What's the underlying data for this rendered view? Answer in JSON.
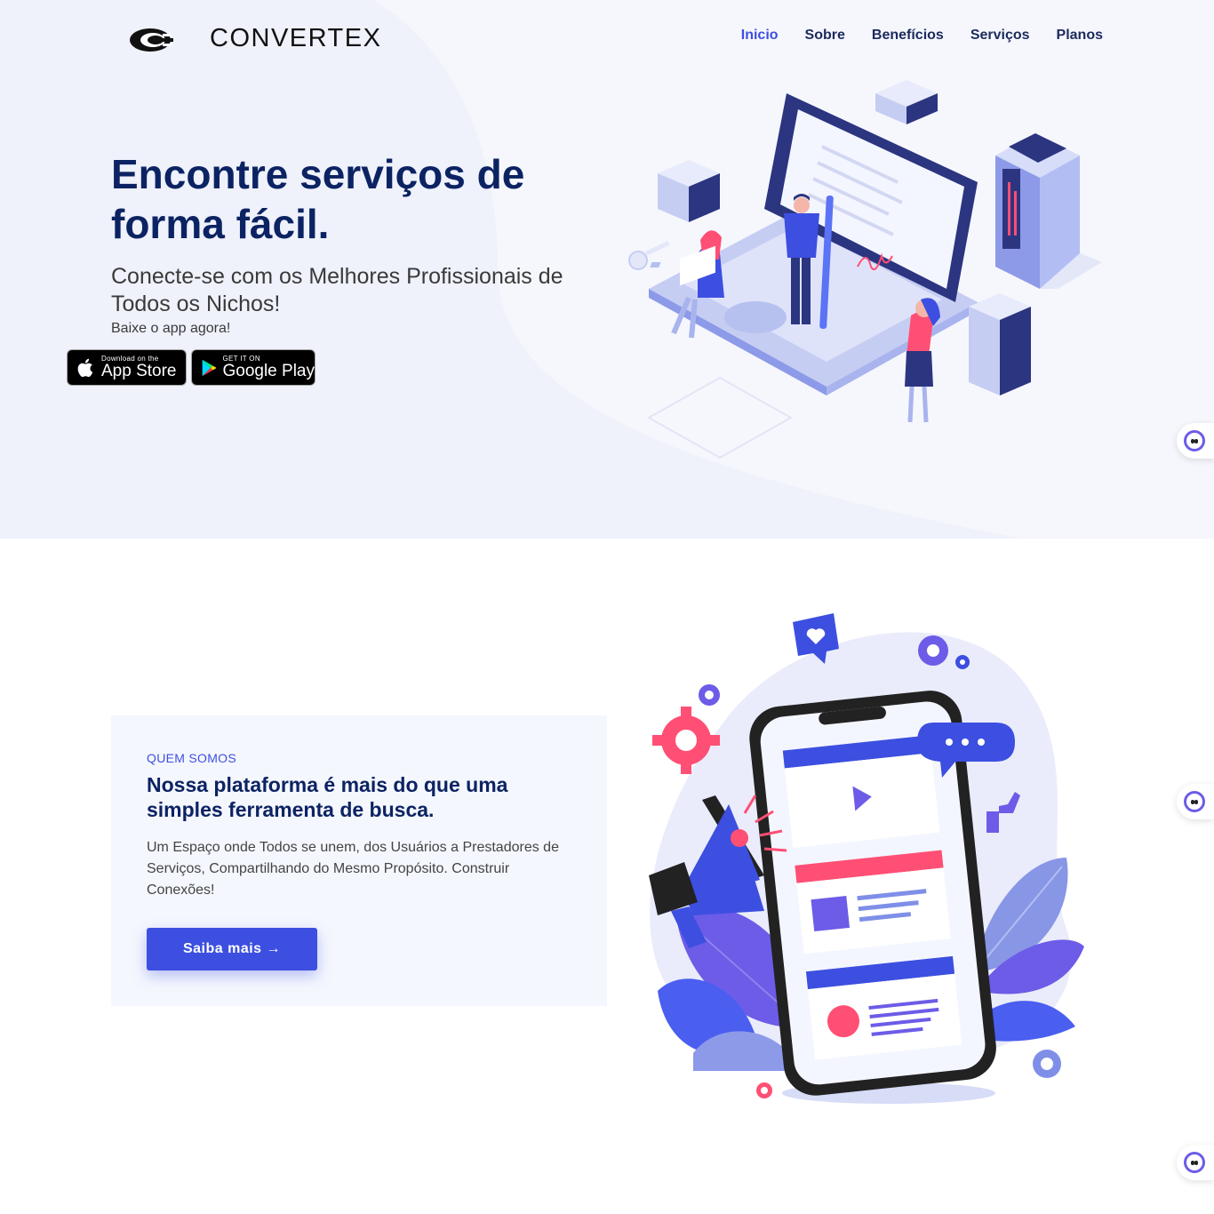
{
  "header": {
    "brand": "CONVERTEX",
    "menu": [
      {
        "label": "Inicio",
        "active": true
      },
      {
        "label": "Sobre",
        "active": false
      },
      {
        "label": "Benefícios",
        "active": false
      },
      {
        "label": "Serviços",
        "active": false
      },
      {
        "label": "Planos",
        "active": false
      }
    ]
  },
  "hero": {
    "title": "Encontre serviços de forma fácil.",
    "subtitle": "Conecte-se com os Melhores Profissionais de Todos os Nichos!",
    "note": "Baixe o app agora!",
    "app_store": {
      "small": "Download on the",
      "big": "App Store"
    },
    "google_play": {
      "small": "GET IT ON",
      "big": "Google Play"
    }
  },
  "about": {
    "kicker": "QUEM SOMOS",
    "title": "Nossa plataforma é mais do que uma simples ferramenta de busca.",
    "text": "Um Espaço onde Todos se unem, dos Usuários a Prestadores de Serviços, Compartilhando do Mesmo Propósito. Construir Conexões!",
    "button": "Saiba mais →"
  },
  "colors": {
    "accent": "#3d4fe0",
    "navy": "#0c2363",
    "hero_bg": "#eff1fb",
    "card_bg": "#f5f7fe",
    "pink": "#ff4f74"
  },
  "icons": [
    "logo-icon",
    "apple-icon",
    "google-play-icon",
    "chat-bot-icon"
  ]
}
